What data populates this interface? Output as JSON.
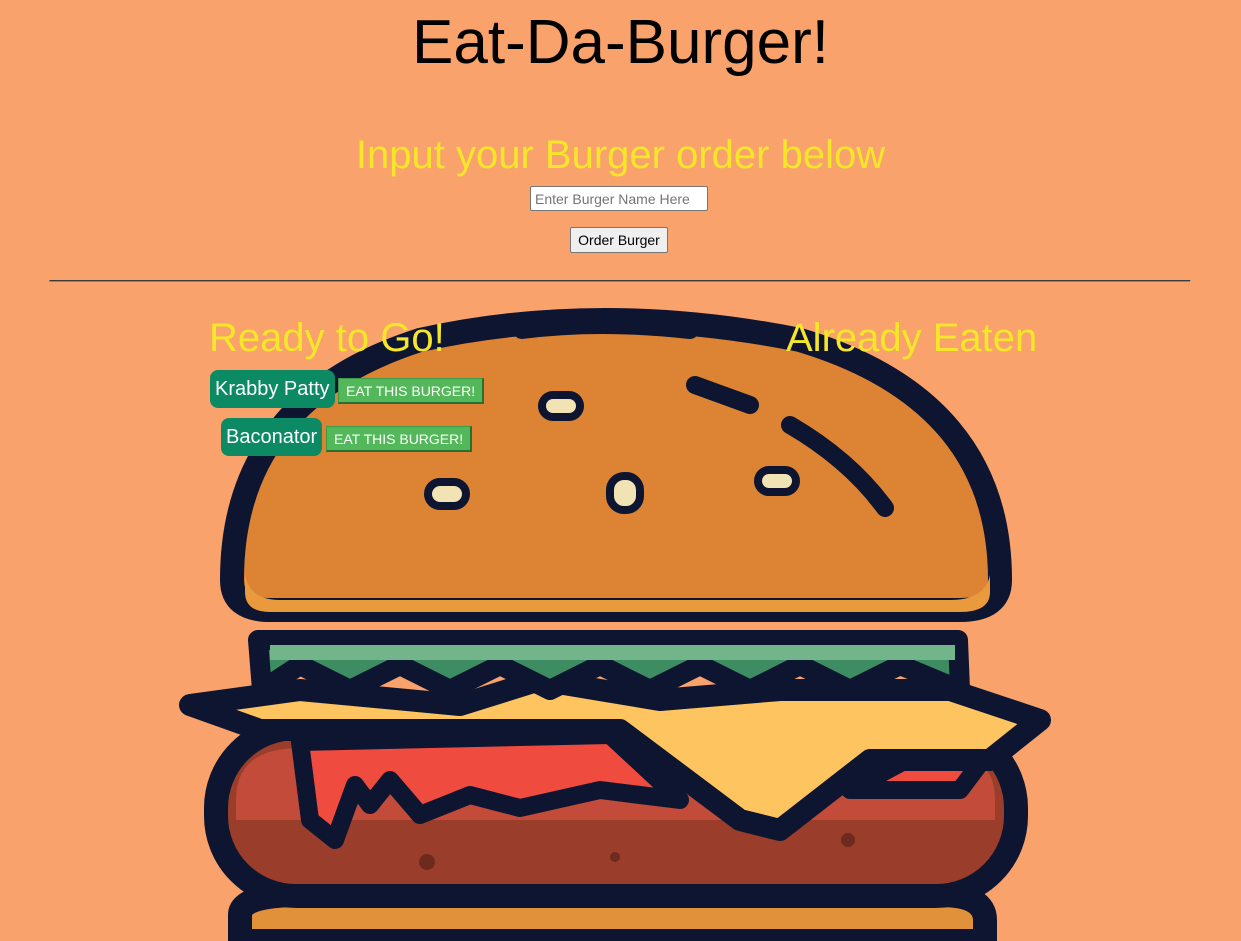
{
  "header": {
    "title": "Eat-Da-Burger!"
  },
  "order_form": {
    "subtitle": "Input your Burger order below",
    "input_placeholder": "Enter Burger Name Here",
    "input_value": "",
    "submit_label": "Order Burger"
  },
  "ready": {
    "heading": "Ready to Go!",
    "burgers": [
      {
        "name": "Krabby Patty",
        "action_label": "EAT THIS BURGER!"
      },
      {
        "name": "Baconator",
        "action_label": "EAT THIS BURGER!"
      }
    ]
  },
  "eaten": {
    "heading": "Already Eaten",
    "burgers": []
  },
  "colors": {
    "background": "#f9a26b",
    "heading_yellow": "#f5e62a",
    "burger_badge": "#0b8a64",
    "eat_button": "#53b85a"
  },
  "background_image": "burger-illustration"
}
